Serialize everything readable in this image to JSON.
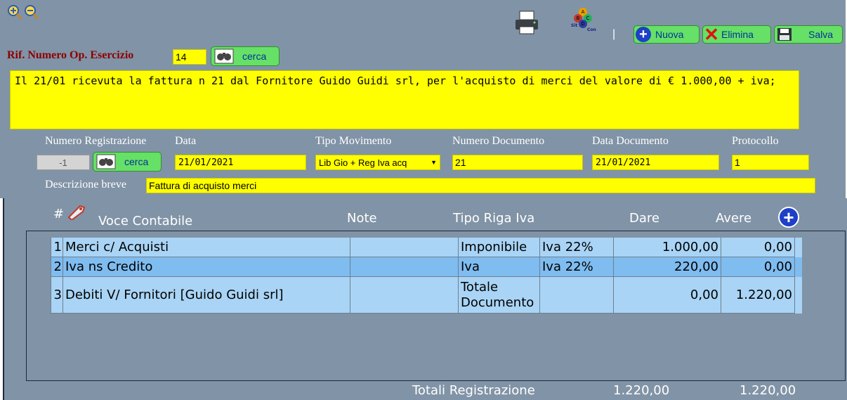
{
  "toolbar": {
    "nuova_label": "Nuova",
    "elimina_label": "Elimina",
    "salva_label": "Salva",
    "separator": "|",
    "logo_letters": [
      "A",
      "B",
      "C",
      "D",
      "Sit",
      "Con"
    ]
  },
  "rif": {
    "label": "Rif. Numero Op. Esercizio",
    "value": "14",
    "cerca_label": "cerca"
  },
  "description_text": "Il 21/01 ricevuta la fattura n 21 dal Fornitore Guido Guidi srl, per l'acquisto di merci del valore di € 1.000,00 + iva;",
  "fields": {
    "numero_registrazione": {
      "label": "Numero Registrazione",
      "value": "-1",
      "cerca_label": "cerca"
    },
    "data": {
      "label": "Data",
      "value": "21/01/2021"
    },
    "tipo_movimento": {
      "label": "Tipo Movimento",
      "value": "Lib Gio + Reg Iva acq"
    },
    "numero_documento": {
      "label": "Numero Documento",
      "value": "21"
    },
    "data_documento": {
      "label": "Data Documento",
      "value": "21/01/2021"
    },
    "protocollo": {
      "label": "Protocollo",
      "value": "1"
    },
    "descrizione_breve": {
      "label": "Descrizione breve",
      "value": "Fattura di acquisto merci"
    }
  },
  "table": {
    "headers": {
      "num": "#",
      "voce": "Voce Contabile",
      "note": "Note",
      "tipo": "Tipo Riga Iva",
      "dare": "Dare",
      "avere": "Avere"
    },
    "rows": [
      {
        "num": "1",
        "voce": "Merci c/ Acquisti",
        "note": "",
        "tipo": "Imponibile",
        "iva": "Iva 22%",
        "dare": "1.000,00",
        "avere": "0,00"
      },
      {
        "num": "2",
        "voce": "Iva ns Credito",
        "note": "",
        "tipo": "Iva",
        "iva": "Iva 22%",
        "dare": "220,00",
        "avere": "0,00"
      },
      {
        "num": "3",
        "voce": "Debiti V/ Fornitori [Guido Guidi srl]",
        "note": "",
        "tipo_line1": "Totale",
        "tipo_line2": "Documento",
        "iva": "",
        "dare": "0,00",
        "avere": "1.220,00"
      }
    ]
  },
  "totals": {
    "label": "Totali Registrazione",
    "dare": "1.220,00",
    "avere": "1.220,00"
  },
  "colors": {
    "background": "#8193a6",
    "field_yellow": "#ffff00",
    "button_green": "#66e066",
    "title_red": "#8b0000",
    "row_blue": "#a9d4f5",
    "row_selected_blue": "#7fbcf0"
  }
}
